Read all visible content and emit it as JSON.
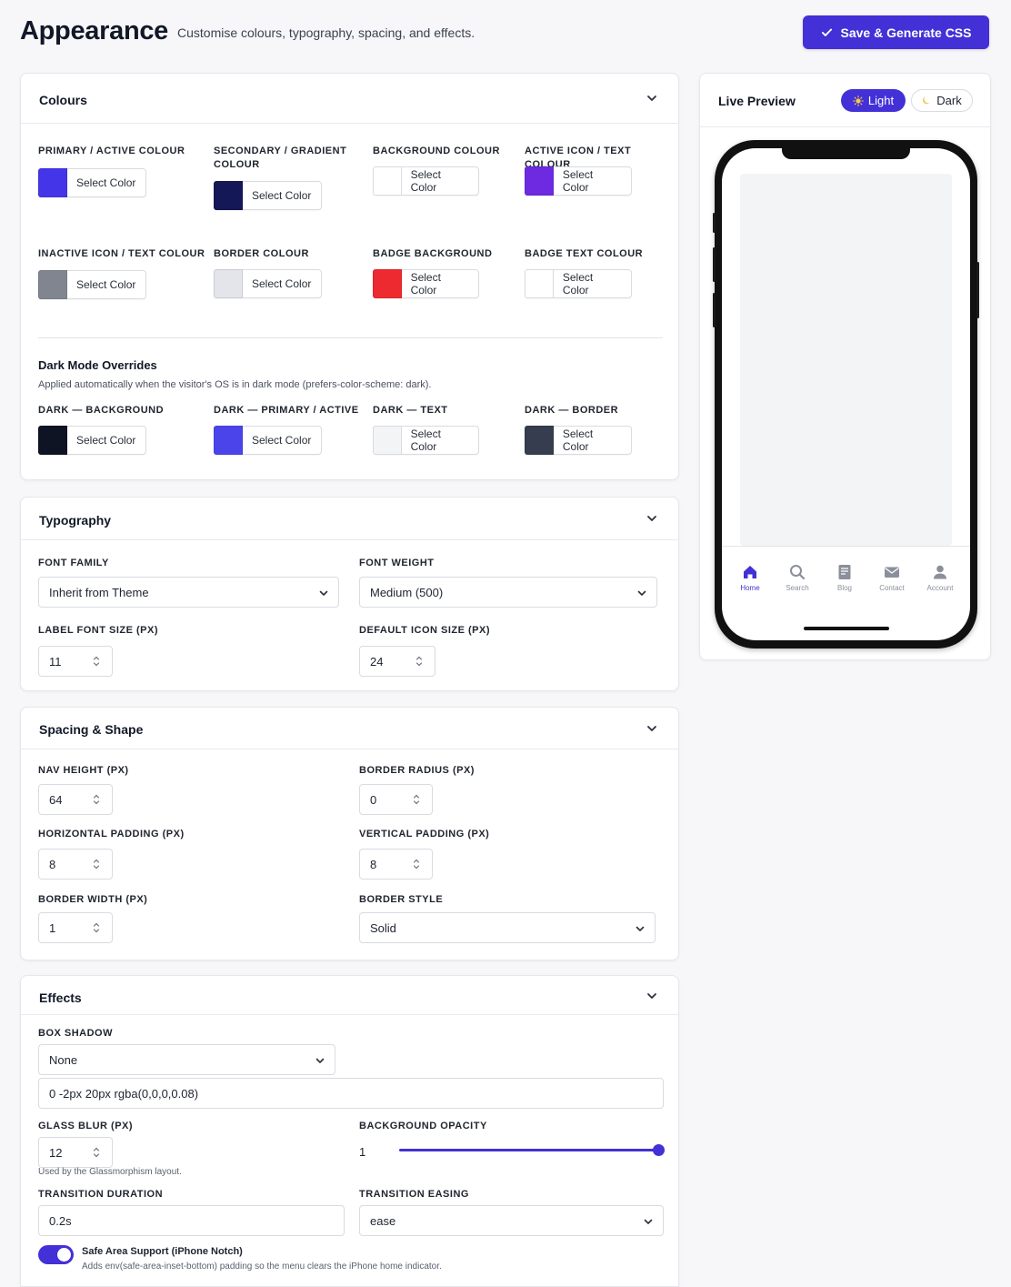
{
  "header": {
    "title": "Appearance",
    "subtitle": "Customise colours, typography, spacing, and effects.",
    "save_label": "Save & Generate CSS"
  },
  "colours": {
    "title": "Colours",
    "select_label": "Select Color",
    "items": [
      {
        "label": "PRIMARY / ACTIVE COLOUR",
        "color": "#4535e8"
      },
      {
        "label": "SECONDARY / GRADIENT",
        "label2": "COLOUR",
        "color": "#141856"
      },
      {
        "label": "BACKGROUND COLOUR",
        "color": "#ffffff"
      },
      {
        "label": "ACTIVE ICON / TEXT COLOUR",
        "color": "#6d2ae0"
      },
      {
        "label": "INACTIVE ICON / TEXT COLOUR",
        "color": "#80858f"
      },
      {
        "label": "BORDER COLOUR",
        "color": "#e3e5ea"
      },
      {
        "label": "BADGE BACKGROUND",
        "color": "#ec2a2f"
      },
      {
        "label": "BADGE TEXT COLOUR",
        "color": "#ffffff"
      }
    ],
    "dark": {
      "title": "Dark Mode Overrides",
      "desc": "Applied automatically when the visitor's OS is in dark mode (prefers-color-scheme: dark).",
      "items": [
        {
          "label": "DARK — BACKGROUND",
          "color": "#0e1424"
        },
        {
          "label": "DARK — PRIMARY / ACTIVE",
          "color": "#4a44ea"
        },
        {
          "label": "DARK — TEXT",
          "color": "#f3f4f6"
        },
        {
          "label": "DARK — BORDER",
          "color": "#353d4f"
        }
      ]
    }
  },
  "typography": {
    "title": "Typography",
    "font_family": {
      "label": "FONT FAMILY",
      "value": "Inherit from Theme"
    },
    "font_weight": {
      "label": "FONT WEIGHT",
      "value": "Medium (500)"
    },
    "label_size": {
      "label": "LABEL FONT SIZE (PX)",
      "value": "11"
    },
    "icon_size": {
      "label": "DEFAULT ICON SIZE (PX)",
      "value": "24"
    }
  },
  "spacing": {
    "title": "Spacing & Shape",
    "nav_height": {
      "label": "NAV HEIGHT (PX)",
      "value": "64"
    },
    "border_radius": {
      "label": "BORDER RADIUS (PX)",
      "value": "0"
    },
    "h_padding": {
      "label": "HORIZONTAL PADDING (PX)",
      "value": "8"
    },
    "v_padding": {
      "label": "VERTICAL PADDING (PX)",
      "value": "8"
    },
    "border_width": {
      "label": "BORDER WIDTH (PX)",
      "value": "1"
    },
    "border_style": {
      "label": "BORDER STYLE",
      "value": "Solid"
    }
  },
  "effects": {
    "title": "Effects",
    "box_shadow": {
      "label": "BOX SHADOW",
      "value": "None",
      "custom": "0 -2px 20px rgba(0,0,0,0.08)"
    },
    "glass_blur": {
      "label": "GLASS BLUR (PX)",
      "value": "12",
      "hint": "Used by the Glassmorphism layout."
    },
    "bg_opacity": {
      "label": "BACKGROUND OPACITY",
      "value": "1",
      "fraction": 1.0
    },
    "transition_duration": {
      "label": "TRANSITION DURATION",
      "value": "0.2s"
    },
    "transition_easing": {
      "label": "TRANSITION EASING",
      "value": "ease"
    },
    "safe_area": {
      "label": "Safe Area Support (iPhone Notch)",
      "desc": "Adds env(safe-area-inset-bottom) padding so the menu clears the iPhone home indicator.",
      "enabled": true
    }
  },
  "preview": {
    "title": "Live Preview",
    "light_label": "Light",
    "dark_label": "Dark",
    "tabs": [
      {
        "label": "Home",
        "icon": "home-icon",
        "active": true
      },
      {
        "label": "Search",
        "icon": "search-icon"
      },
      {
        "label": "Blog",
        "icon": "document-icon"
      },
      {
        "label": "Contact",
        "icon": "mail-icon"
      },
      {
        "label": "Account",
        "icon": "user-icon"
      }
    ]
  },
  "theme": {
    "accent": "#4330d6"
  }
}
